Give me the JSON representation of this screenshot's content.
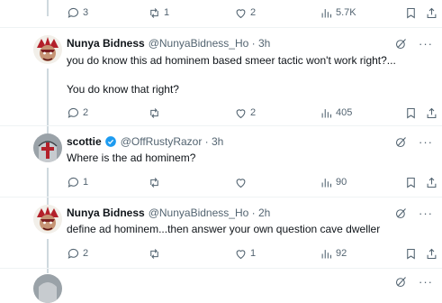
{
  "top_actions": {
    "replies": "3",
    "reposts": "1",
    "likes": "2",
    "views": "5.7K"
  },
  "tweets": [
    {
      "name": "Nunya Bidness",
      "meta": "@NunyaBidness_Ho · 3h",
      "text1": "you do know this ad hominem based smeer tactic won't work right?...",
      "text2": "You do know that right?",
      "replies": "2",
      "reposts": "",
      "likes": "2",
      "views": "405"
    },
    {
      "name": "scottie",
      "meta": "@OffRustyRazor · 3h",
      "text1": "Where is the ad hominem?",
      "replies": "1",
      "reposts": "",
      "likes": "",
      "views": "90"
    },
    {
      "name": "Nunya Bidness",
      "meta": "@NunyaBidness_Ho · 2h",
      "text1": "define ad hominem...then answer your own question cave dweller",
      "replies": "2",
      "reposts": "",
      "likes": "1",
      "views": "92"
    }
  ],
  "colors": {
    "verified": "#1d9bf0",
    "muted": "#536471",
    "text": "#0f1419"
  }
}
